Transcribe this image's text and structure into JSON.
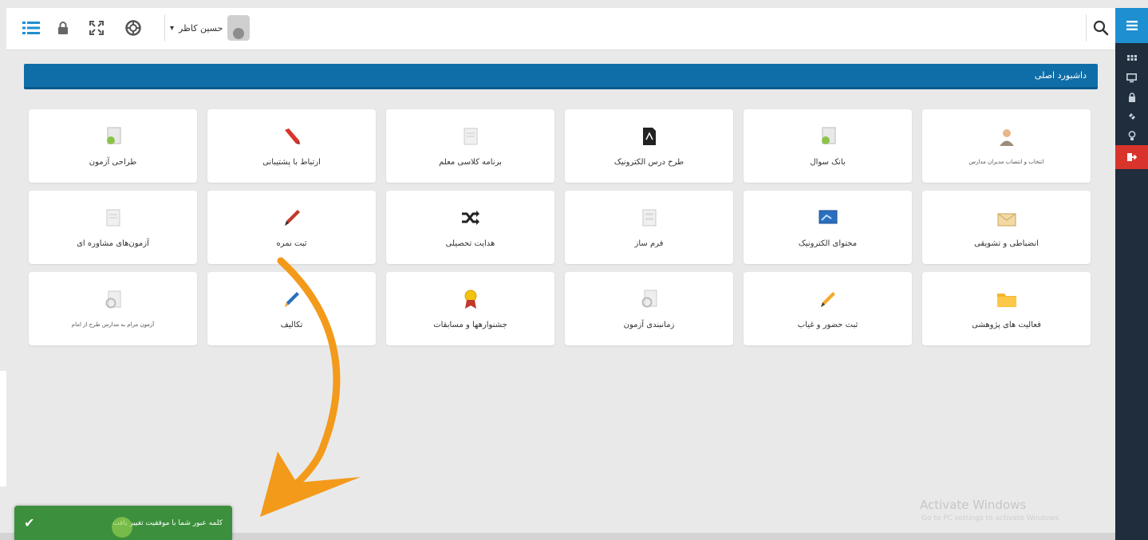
{
  "header": {
    "user_name": "حسین کاظر",
    "user_caret": "▾"
  },
  "banner": {
    "title": "داشبورد اصلی"
  },
  "tiles": [
    {
      "label": "انتخاب و انتصاب مدیران مدارس",
      "icon": "user-icon",
      "small": true
    },
    {
      "label": "بانک سوال",
      "icon": "document-cd-icon"
    },
    {
      "label": "طرح درس الکترونیک",
      "icon": "pdf-icon"
    },
    {
      "label": "برنامه کلاسی معلم",
      "icon": "document-icon"
    },
    {
      "label": "ارتباط با پشتیبانی",
      "icon": "pin-icon"
    },
    {
      "label": "طراحی آزمون",
      "icon": "document-cd-icon"
    },
    {
      "label": "انضباطی و تشویقی",
      "icon": "envelope-icon"
    },
    {
      "label": "محتوای الکترونیک",
      "icon": "monitor-icon"
    },
    {
      "label": "فرم ساز",
      "icon": "form-icon"
    },
    {
      "label": "هدایت تحصیلی",
      "icon": "shuffle-icon"
    },
    {
      "label": "ثبت نمره",
      "icon": "pen-icon"
    },
    {
      "label": "آزمون‌های مشاوره ای",
      "icon": "document-icon"
    },
    {
      "label": "فعالیت های پژوهشی",
      "icon": "folder-icon"
    },
    {
      "label": "ثبت حضور و غیاب",
      "icon": "pencil-icon"
    },
    {
      "label": "زمانبندی آزمون",
      "icon": "document-gear-icon"
    },
    {
      "label": "جشنوارهها و مسابقات",
      "icon": "award-icon"
    },
    {
      "label": "تکالیف",
      "icon": "pencil-blue-icon"
    },
    {
      "label": "آزمون مرام به مدارس طرح از امام",
      "icon": "document-gear-icon",
      "small": true
    }
  ],
  "toast": {
    "message": "کلمه عبور شما با موفقیت تغییر یافت",
    "check": "✔"
  },
  "watermark": {
    "line1": "Activate Windows",
    "line2": "Go to PC settings to activate Windows."
  },
  "colors": {
    "brand_blue": "#0f6ea8",
    "sidebar_dark": "#1f2d3d",
    "accent_red": "#d9342b",
    "success_green": "#3c8f3c",
    "arrow_orange": "#f39a1b"
  }
}
